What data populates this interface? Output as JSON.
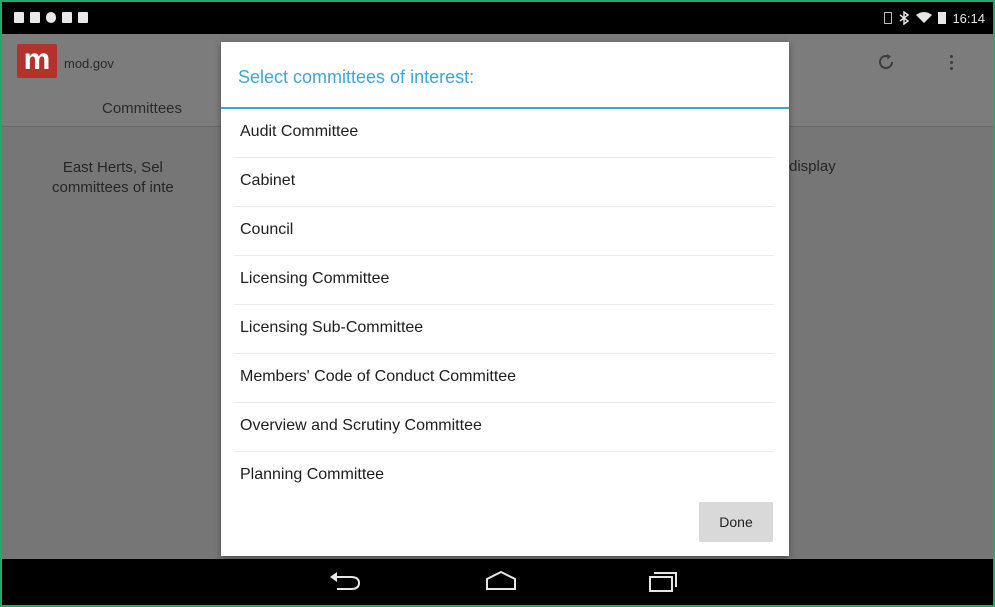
{
  "status_bar": {
    "time": "16:14"
  },
  "app_bar": {
    "logo_letter": "m",
    "title": "mod.gov"
  },
  "tabs": {
    "committees": "Committees"
  },
  "content": {
    "left_line1": "East Herts, Sel",
    "left_line2": "committees of inte",
    "right_text": "display"
  },
  "dialog": {
    "title": "Select committees of interest:",
    "items": [
      "Audit Committee",
      "Cabinet",
      "Council",
      "Licensing Committee",
      "Licensing Sub-Committee",
      "Members' Code of Conduct Committee",
      "Overview and Scrutiny Committee",
      "Planning Committee"
    ],
    "done_label": "Done"
  },
  "colors": {
    "accent": "#3fa6d4",
    "logo": "#b3322c",
    "frame_border": "#23a86b"
  },
  "icons": {
    "appbar": [
      "refresh-icon",
      "overflow-menu-icon"
    ],
    "navbar": [
      "back-icon",
      "home-icon",
      "recent-apps-icon"
    ]
  }
}
